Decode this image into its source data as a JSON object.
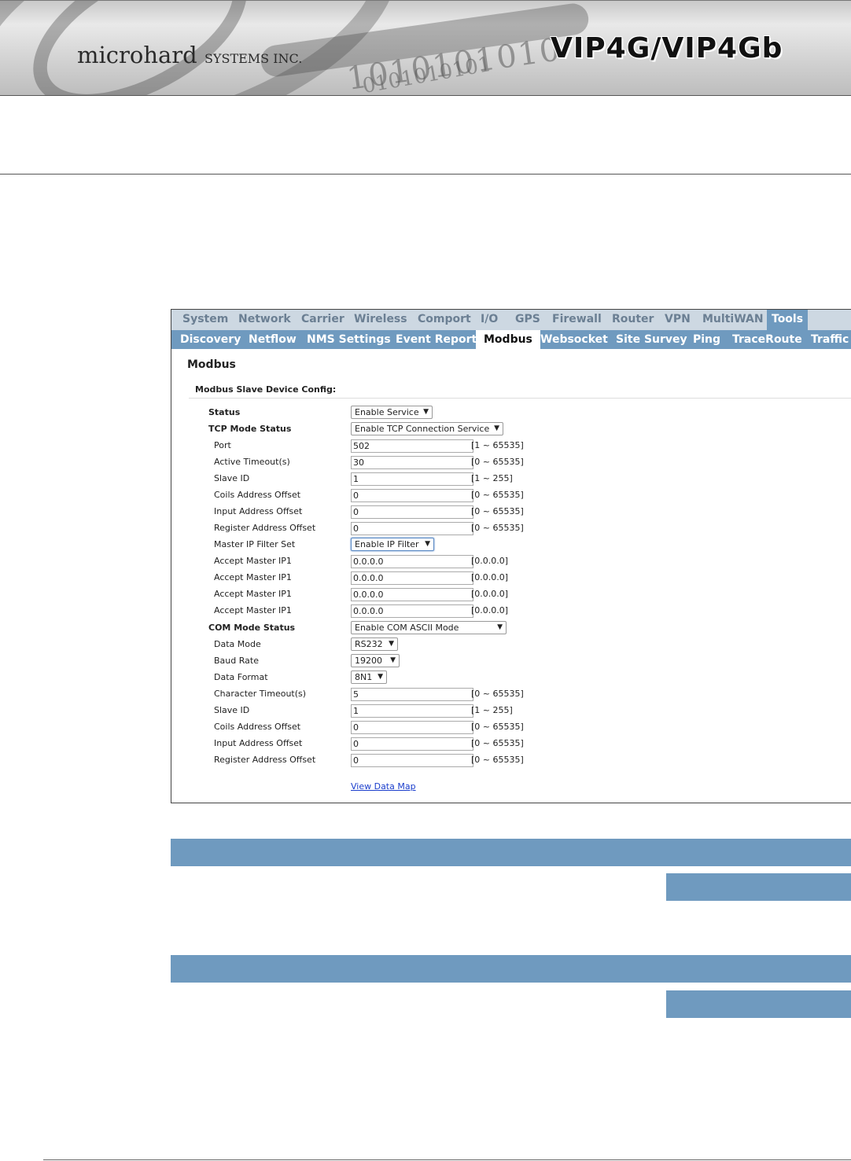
{
  "header": {
    "company_main": "microhard",
    "company_suffix": "SYSTEMS INC.",
    "product": "VIP4G/VIP4Gb",
    "binary_art_1": "1010101010",
    "binary_art_2": "0101010101"
  },
  "menu_top": [
    "System",
    "Network",
    "Carrier",
    "Wireless",
    "Comport",
    "I/O",
    "GPS",
    "Firewall",
    "Router",
    "VPN",
    "MultiWAN",
    "Tools"
  ],
  "menu_top_active": "Tools",
  "menu_sub": [
    "Discovery",
    "Netflow",
    "NMS Settings",
    "Event Report",
    "Modbus",
    "Websocket",
    "Site Survey",
    "Ping",
    "TraceRoute",
    "Traffic"
  ],
  "menu_sub_active": "Modbus",
  "page_title": "Modbus",
  "section_title": "Modbus Slave Device Config:",
  "form": {
    "status": {
      "label": "Status",
      "value": "Enable Service"
    },
    "tcp_mode": {
      "label": "TCP Mode Status",
      "value": "Enable TCP Connection Service"
    },
    "tcp_port": {
      "label": "Port",
      "value": "502",
      "range": "[1 ~ 65535]"
    },
    "tcp_active_timeout": {
      "label": "Active Timeout(s)",
      "value": "30",
      "range": "[0 ~ 65535]"
    },
    "tcp_slave_id": {
      "label": "Slave ID",
      "value": "1",
      "range": "[1 ~ 255]"
    },
    "tcp_coils_offset": {
      "label": "Coils Address Offset",
      "value": "0",
      "range": "[0 ~ 65535]"
    },
    "tcp_input_offset": {
      "label": "Input Address Offset",
      "value": "0",
      "range": "[0 ~ 65535]"
    },
    "tcp_register_offset": {
      "label": "Register Address Offset",
      "value": "0",
      "range": "[0 ~ 65535]"
    },
    "master_ip_filter": {
      "label": "Master IP Filter Set",
      "value": "Enable IP Filter"
    },
    "accept_ip_1": {
      "label": "Accept Master IP1",
      "value": "0.0.0.0",
      "range": "[0.0.0.0]"
    },
    "accept_ip_2": {
      "label": "Accept Master IP1",
      "value": "0.0.0.0",
      "range": "[0.0.0.0]"
    },
    "accept_ip_3": {
      "label": "Accept Master IP1",
      "value": "0.0.0.0",
      "range": "[0.0.0.0]"
    },
    "accept_ip_4": {
      "label": "Accept Master IP1",
      "value": "0.0.0.0",
      "range": "[0.0.0.0]"
    },
    "com_mode": {
      "label": "COM Mode Status",
      "value": "Enable COM ASCII Mode"
    },
    "data_mode": {
      "label": "Data Mode",
      "value": "RS232"
    },
    "baud_rate": {
      "label": "Baud Rate",
      "value": "19200"
    },
    "data_format": {
      "label": "Data Format",
      "value": "8N1"
    },
    "char_timeout": {
      "label": "Character Timeout(s)",
      "value": "5",
      "range": "[0 ~ 65535]"
    },
    "com_slave_id": {
      "label": "Slave ID",
      "value": "1",
      "range": "[1 ~ 255]"
    },
    "com_coils_offset": {
      "label": "Coils Address Offset",
      "value": "0",
      "range": "[0 ~ 65535]"
    },
    "com_input_offset": {
      "label": "Input Address Offset",
      "value": "0",
      "range": "[0 ~ 65535]"
    },
    "com_register_offset": {
      "label": "Register Address Offset",
      "value": "0",
      "range": "[0 ~ 65535]"
    }
  },
  "view_data_map": "View Data Map",
  "arrow_glyph": "▼"
}
